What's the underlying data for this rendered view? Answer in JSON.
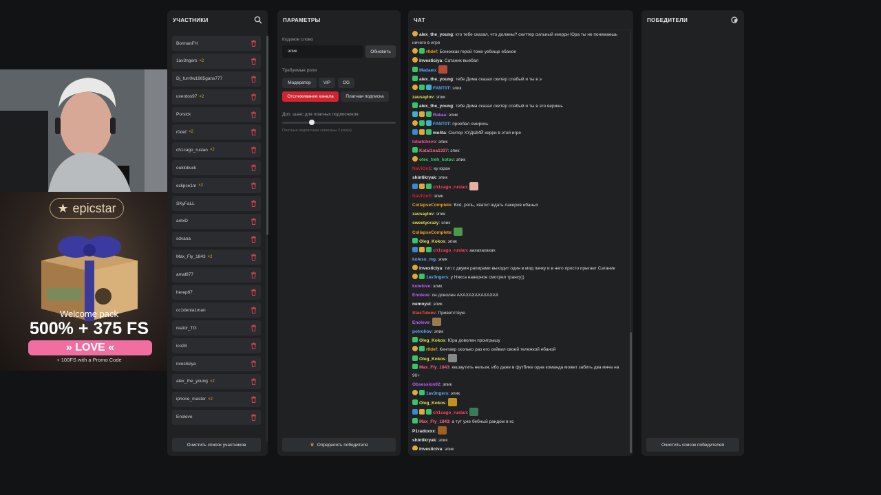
{
  "participants": {
    "title": "УЧАСТНИКИ",
    "clear_label": "Очистить список участников",
    "items": [
      {
        "name": "BormanFH",
        "badge": ""
      },
      {
        "name": "1av3ngers",
        "badge": "×2"
      },
      {
        "name": "Dj_furr0w1985gans777",
        "badge": ""
      },
      {
        "name": "uverdos97",
        "badge": "×2"
      },
      {
        "name": "Porsick",
        "badge": ""
      },
      {
        "name": "r0def",
        "badge": "×2"
      },
      {
        "name": "ch1cago_ruslan",
        "badge": "×2"
      },
      {
        "name": "ouklobuck",
        "badge": ""
      },
      {
        "name": "eclipse1m",
        "badge": "×2"
      },
      {
        "name": "SKyFaLL",
        "badge": ""
      },
      {
        "name": "antxD",
        "badge": ""
      },
      {
        "name": "sdvana",
        "badge": ""
      },
      {
        "name": "Max_Fly_1843",
        "badge": "×2"
      },
      {
        "name": "amal877",
        "badge": ""
      },
      {
        "name": "herep67",
        "badge": ""
      },
      {
        "name": "cc1denta1man",
        "badge": ""
      },
      {
        "name": "reator_TG",
        "badge": ""
      },
      {
        "name": "ico28",
        "badge": ""
      },
      {
        "name": "nvesticiya",
        "badge": ""
      },
      {
        "name": "alex_the_young",
        "badge": "×2"
      },
      {
        "name": "iphone_master",
        "badge": "×2"
      },
      {
        "name": "Enoleve",
        "badge": ""
      }
    ]
  },
  "params": {
    "title": "ПАРАМЕТРЫ",
    "keyword_label": "Кодовое слово",
    "keyword_value": "эпик",
    "update_label": "Обновить",
    "roles_label": "Требуемые роли",
    "roles": [
      "Модератор",
      "VIP",
      "OG"
    ],
    "roles2": [
      "Отслеживание канала",
      "Платная подписка"
    ],
    "chance_label": "Доп. шанс для платных подписчиков",
    "chance_note": "Платные подписчики записаны 2 раз(а)",
    "determine_label": "Определить победителя"
  },
  "chat": {
    "title": "ЧАТ",
    "messages": [
      {
        "badges": [
          "#e0a93a"
        ],
        "nick": "alex_the_young",
        "color": "#e8e8e8",
        "text": "кто тебе сказал, что должны? скиттер сильный кеерри Юра ты не понимаешь ничего в игре",
        "two": true
      },
      {
        "badges": [
          "#e0a93a",
          "#3ac46a"
        ],
        "nick": "r0def",
        "color": "#f0a020",
        "text": "Бонюккак герой тоже уебище ебаное"
      },
      {
        "badges": [
          "#e0a93a"
        ],
        "nick": "investiciya",
        "color": "#e8e8e8",
        "text": "Сатаник выебал"
      },
      {
        "badges": [
          "#3ac46a"
        ],
        "nick": "Madaeo",
        "color": "#5fa8ff",
        "text": "",
        "emote": "#b84a3a"
      },
      {
        "badges": [
          "#3ac46a"
        ],
        "nick": "alex_the_young",
        "color": "#e8e8e8",
        "text": "тебе Дима сказал скитер слабый и ты в э"
      },
      {
        "badges": [
          "#e0a93a",
          "#3ac46a",
          "#40b0d0"
        ],
        "nick": "FANT0T",
        "color": "#5fa8ff",
        "text": "эпик"
      },
      {
        "badges": [],
        "nick": "zausaylov",
        "color": "#e0e050",
        "text": "эпик"
      },
      {
        "badges": [
          "#3ac46a"
        ],
        "nick": "alex_the_young",
        "color": "#e8e8e8",
        "text": "тебе Дима сказал скитер слабый и ты в это веришь"
      },
      {
        "badges": [
          "#40b0d0",
          "#e0a93a",
          "#3ac46a"
        ],
        "nick": "Rakaa",
        "color": "#c060ff",
        "text": "эпик"
      },
      {
        "badges": [
          "#e0a93a",
          "#3ac46a",
          "#40b0d0"
        ],
        "nick": "FANT0T",
        "color": "#5fa8ff",
        "text": "проебал смирись"
      },
      {
        "badges": [
          "#3a8ad0",
          "#e0a93a",
          "#3ac46a"
        ],
        "nick": "me4ta",
        "color": "#e8e8e8",
        "text": "Скитер ХУДШИЙ керри в этой игре"
      },
      {
        "badges": [],
        "nick": "lobatchevo",
        "color": "#ff4fa0",
        "text": "эпик"
      },
      {
        "badges": [
          "#3ac46a"
        ],
        "nick": "Katal1na1337",
        "color": "#ff6080",
        "text": "эпик"
      },
      {
        "badges": [
          "#e0a93a"
        ],
        "nick": "otec_treh_kotov",
        "color": "#3ad070",
        "text": "эпик"
      },
      {
        "badges": [],
        "nick": "NaViOnE",
        "color": "#d02030",
        "text": "ку юран"
      },
      {
        "badges": [],
        "nick": "shintikryak",
        "color": "#e8e8e8",
        "text": "эпик"
      },
      {
        "badges": [
          "#3a8ad0",
          "#e0a93a",
          "#3ac46a"
        ],
        "nick": "ch1cago_ruslan",
        "color": "#ff4060",
        "text": "",
        "emote": "#e8b0a0"
      },
      {
        "badges": [],
        "nick": "NaVIOnE",
        "color": "#d02030",
        "text": "эпик"
      },
      {
        "badges": [],
        "nick": "CollapseComplete",
        "color": "#f0a020",
        "text": "Всё, роль, хватит ждать лакеров ебаных"
      },
      {
        "badges": [],
        "nick": "zausaylov",
        "color": "#e0e050",
        "text": "эпик"
      },
      {
        "badges": [],
        "nick": "sweetycrazy",
        "color": "#e0e050",
        "text": "эпик"
      },
      {
        "badges": [],
        "nick": "CollapseComplete",
        "color": "#f0a020",
        "text": "",
        "emote": "#4a9a4a"
      },
      {
        "badges": [
          "#3ac46a"
        ],
        "nick": "Oleg_Kokos",
        "color": "#e0e050",
        "text": "эпик"
      },
      {
        "badges": [
          "#3a8ad0",
          "#e0a93a",
          "#3ac46a"
        ],
        "nick": "ch1cago_ruslan",
        "color": "#ff4060",
        "text": "аахахахахах"
      },
      {
        "badges": [],
        "nick": "koleso_mg",
        "color": "#5fa8ff",
        "text": "эпик"
      },
      {
        "badges": [
          "#e0a93a"
        ],
        "nick": "investiciya",
        "color": "#e8e8e8",
        "text": "тип с двумя рапирами выходит один в мид пачку и в него просто прыгает Сатаник"
      },
      {
        "badges": [
          "#e0a93a",
          "#3ac46a"
        ],
        "nick": "1av3ngers",
        "color": "#5fa8ff",
        "text": "у Никса наверное смотрел трансу))"
      },
      {
        "badges": [],
        "nick": "kotelove",
        "color": "#c060ff",
        "text": "эпик"
      },
      {
        "badges": [],
        "nick": "Enoleve",
        "color": "#c060ff",
        "text": "он доволен АХАХАХАХАХАХАХ"
      },
      {
        "badges": [],
        "nick": "nemoyul",
        "color": "#e8e8e8",
        "text": "эпик"
      },
      {
        "badges": [],
        "nick": "StasTuleev",
        "color": "#ff5040",
        "text": "Приветствую"
      },
      {
        "badges": [],
        "nick": "Enoleve",
        "color": "#c060ff",
        "text": "",
        "emote": "#9a7a50"
      },
      {
        "badges": [],
        "nick": "potrohov",
        "color": "#5fa8ff",
        "text": "эпик"
      },
      {
        "badges": [
          "#3ac46a"
        ],
        "nick": "Oleg_Kokos",
        "color": "#e0e050",
        "text": "Юра доволен проигрышу"
      },
      {
        "badges": [
          "#e0a93a",
          "#3ac46a"
        ],
        "nick": "r0def",
        "color": "#f0a020",
        "text": "Кентавр сколько раз его сейвил своей тележкой ебаной"
      },
      {
        "badges": [
          "#3ac46a"
        ],
        "nick": "Oleg_Kokos",
        "color": "#e0e050",
        "text": "",
        "emote": "#888888"
      },
      {
        "badges": [
          "#3ac46a"
        ],
        "nick": "Max_Fly_1843",
        "color": "#ff6080",
        "text": "кешаутить нельзя, ибо даже в футбике одна команда может забить два мяча на 90+",
        "two": true
      },
      {
        "badges": [],
        "nick": "Obsession02",
        "color": "#c060ff",
        "text": "эпик"
      },
      {
        "badges": [
          "#e0a93a",
          "#3ac46a"
        ],
        "nick": "1av3ngers",
        "color": "#5fa8ff",
        "text": "эпик"
      },
      {
        "badges": [
          "#3ac46a"
        ],
        "nick": "Oleg_Kokos",
        "color": "#e0e050",
        "text": "",
        "emote": "#c09020"
      },
      {
        "badges": [
          "#3a8ad0",
          "#e0a93a",
          "#3ac46a"
        ],
        "nick": "ch1cago_ruslan",
        "color": "#ff4060",
        "text": "",
        "emote": "#3a7a5a"
      },
      {
        "badges": [
          "#3ac46a"
        ],
        "nick": "Max_Fly_1843",
        "color": "#ff6080",
        "text": "а тут уже бебный рандом в кс"
      },
      {
        "badges": [],
        "nick": "P1radoxxx",
        "color": "#e8e8e8",
        "text": "",
        "emote": "#a06020"
      },
      {
        "badges": [],
        "nick": "shintikryak",
        "color": "#e8e8e8",
        "text": "эпик"
      },
      {
        "badges": [
          "#e0a93a"
        ],
        "nick": "investiciya",
        "color": "#e8e8e8",
        "text": "эпик"
      }
    ]
  },
  "winners": {
    "title": "ПОБЕДИТЕЛИ",
    "clear_label": "Очистить список победителей"
  },
  "ad": {
    "brand": "epicstar",
    "welcome": "Welcome pack",
    "offer": "500% + 375 FS",
    "code": "» LOVE «",
    "promo": "+ 100FS with a Promo Code"
  }
}
